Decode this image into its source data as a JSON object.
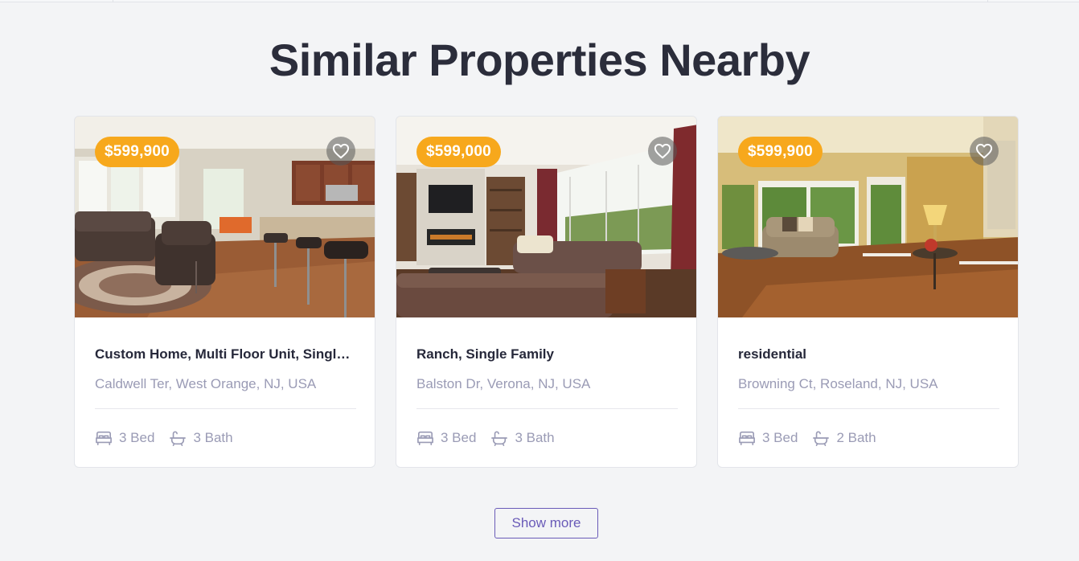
{
  "section": {
    "title": "Similar Properties Nearby"
  },
  "properties": [
    {
      "price": "$599,900",
      "title": "Custom Home, Multi Floor Unit, Single ...",
      "address": "Caldwell Ter, West Orange, NJ, USA",
      "beds": "3 Bed",
      "baths": "3 Bath"
    },
    {
      "price": "$599,000",
      "title": "Ranch, Single Family",
      "address": "Balston Dr, Verona, NJ, USA",
      "beds": "3 Bed",
      "baths": "3 Bath"
    },
    {
      "price": "$599,900",
      "title": "residential",
      "address": "Browning Ct, Roseland, NJ, USA",
      "beds": "3 Bed",
      "baths": "2 Bath"
    }
  ],
  "actions": {
    "show_more_label": "Show more"
  },
  "icons": {
    "favorite": "heart-icon",
    "bed": "bed-icon",
    "bath": "bathtub-icon"
  },
  "colors": {
    "price_badge": "#f7a81c",
    "accent": "#6a5bb8",
    "muted_text": "#9a9bb5",
    "heading": "#2b2d3b"
  }
}
